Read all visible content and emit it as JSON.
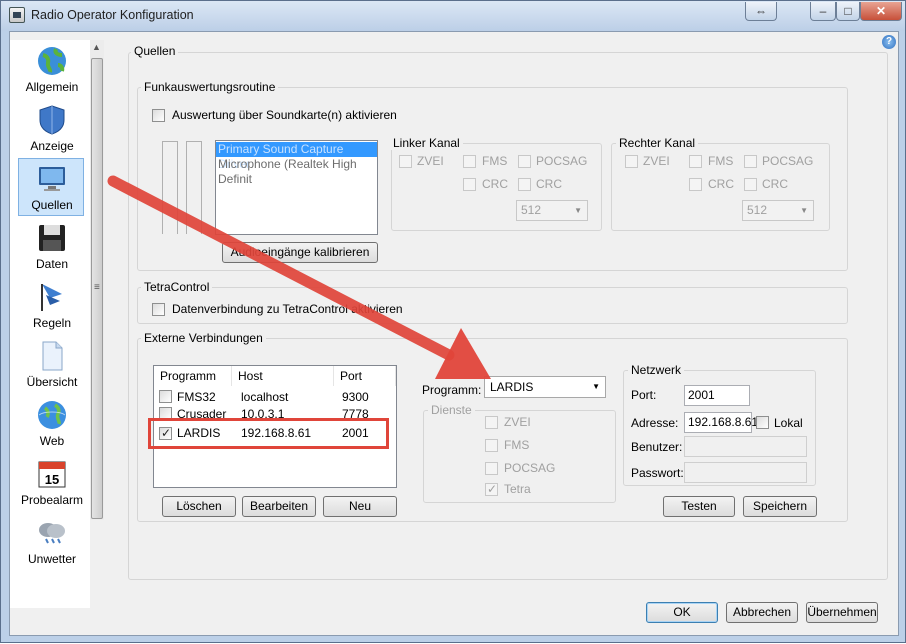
{
  "window": {
    "title": "Radio Operator Konfiguration"
  },
  "titlebar_buttons": {
    "restore": "⇔",
    "minimize": "–",
    "maximize": "□",
    "close": "✕"
  },
  "help": "?",
  "sidebar": {
    "items": [
      {
        "label": "Allgemein",
        "icon": "globe-icon"
      },
      {
        "label": "Anzeige",
        "icon": "shield-icon"
      },
      {
        "label": "Quellen",
        "icon": "monitor-icon"
      },
      {
        "label": "Daten",
        "icon": "floppy-disk-icon"
      },
      {
        "label": "Regeln",
        "icon": "flag-icon"
      },
      {
        "label": "Übersicht",
        "icon": "document-icon"
      },
      {
        "label": "Web",
        "icon": "web-globe-icon"
      },
      {
        "label": "Probealarm",
        "icon": "calendar-icon",
        "icon_text": "15"
      },
      {
        "label": "Unwetter",
        "icon": "storm-cloud-icon"
      }
    ]
  },
  "quellen": {
    "title": "Quellen",
    "funk": {
      "title": "Funkauswertungsroutine",
      "soundcard_checkbox": "Auswertung über Soundkarte(n) aktivieren",
      "devices": [
        "Primary Sound Capture Driver",
        "Microphone (Realtek High Definit"
      ],
      "calibrate_button": "Audioeingänge kalibrieren",
      "left": {
        "title": "Linker Kanal",
        "zvei": "ZVEI",
        "fms": "FMS",
        "pocsag": "POCSAG",
        "crc1": "CRC",
        "crc2": "CRC",
        "baud": "512"
      },
      "right": {
        "title": "Rechter Kanal",
        "zvei": "ZVEI",
        "fms": "FMS",
        "pocsag": "POCSAG",
        "crc1": "CRC",
        "crc2": "CRC",
        "baud": "512"
      }
    },
    "tetra": {
      "title": "TetraControl",
      "checkbox": "Datenverbindung zu TetraControl aktivieren"
    },
    "extern": {
      "title": "Externe Verbindungen",
      "columns": [
        "Programm",
        "Host",
        "Port"
      ],
      "rows": [
        {
          "program": "FMS32",
          "host": "localhost",
          "port": "9300",
          "checked": false
        },
        {
          "program": "Crusader",
          "host": "10.0.3.1",
          "port": "7778",
          "checked": false
        },
        {
          "program": "LARDIS",
          "host": "192.168.8.61",
          "port": "2001",
          "checked": true
        }
      ],
      "delete_button": "Löschen",
      "edit_button": "Bearbeiten",
      "new_button": "Neu",
      "program_label": "Programm:",
      "program_value": "LARDIS",
      "services": {
        "title": "Dienste",
        "zvei": "ZVEI",
        "fms": "FMS",
        "pocsag": "POCSAG",
        "tetra": "Tetra",
        "tetra_checked": true
      },
      "network": {
        "title": "Netzwerk",
        "port_label": "Port:",
        "port_value": "2001",
        "address_label": "Adresse:",
        "address_value": "192.168.8.61",
        "local_label": "Lokal",
        "user_label": "Benutzer:",
        "user_value": "",
        "password_label": "Passwort:",
        "password_value": ""
      },
      "test_button": "Testen",
      "save_button": "Speichern"
    }
  },
  "footer": {
    "ok": "OK",
    "cancel": "Abbrechen",
    "apply": "Übernehmen"
  },
  "colors": {
    "annotation_red": "#e0453a",
    "selection_blue": "#3399ff"
  }
}
